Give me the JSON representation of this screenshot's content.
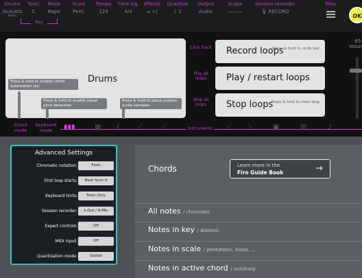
{
  "topbar": {
    "items": [
      {
        "label": "Drums",
        "value": "Acoustic",
        "sub": "Basic"
      },
      {
        "label": "Tonic",
        "value": "C"
      },
      {
        "label": "Mode",
        "value": "Major"
      },
      {
        "label": "Scale",
        "value": "Pent."
      },
      {
        "label": "Tempo",
        "value": "129"
      },
      {
        "label": "Time sig.",
        "value": "4/4"
      },
      {
        "label": "Effects",
        "value": "⩕ >|"
      },
      {
        "label": "Quantize",
        "value": "♪ 2"
      },
      {
        "label": "Output",
        "value": "Audio"
      },
      {
        "label": "Scope",
        "value": "———"
      },
      {
        "label": "Session recorder",
        "value": "🎙 RECORD"
      },
      {
        "label": "Files",
        "value": ""
      }
    ],
    "key_label": "Key",
    "ok_label": "OK",
    "accent_color": "#d63be0"
  },
  "drums": {
    "title": "Drums",
    "hints": {
      "chord_auto": "Press & hold to enable chord automation rec.",
      "pitch_detect": "Press & hold to enable visual pitch detection",
      "custom_samples": "Press & hold to place custom audio samples"
    }
  },
  "middle_buttons": {
    "click_track": "Click track",
    "play_all": "Play all loops",
    "stop_all": "Stop all loops"
  },
  "loops": {
    "record": {
      "label": "Record loops",
      "hint": "Press & hold to undo last"
    },
    "play": {
      "label": "Play / restart loops"
    },
    "stop": {
      "label": "Stop loops",
      "hint": "Press & hold to clear loop"
    }
  },
  "volume": {
    "value": "65",
    "label": "Volume"
  },
  "modes": {
    "chord_mode": "Chord mode",
    "keyboard_mode": "Keyboard mode",
    "instruments": "Instruments"
  },
  "main": {
    "chords_title": "Chords",
    "guide": {
      "line1": "Learn more in the",
      "line2": "Firo Guide Book",
      "arrow": "→"
    },
    "rows": [
      {
        "main": "All notes",
        "sub": "/ chromatic"
      },
      {
        "main": "Notes in key",
        "sub": "/ diatonic"
      },
      {
        "main": "Notes in scale",
        "sub": "/ pentatonic, blues, ..."
      },
      {
        "main": "Notes in active chord",
        "sub": "/ autoharp"
      }
    ]
  },
  "settings": {
    "title": "Advanced Settings",
    "rows": [
      {
        "label": "Chromatic notation:",
        "value": "Flats"
      },
      {
        "label": "First loop starts:",
        "value": "Beat Sync'd"
      },
      {
        "label": "Keyboard hints:",
        "value": "Tonic Only"
      },
      {
        "label": "Session recorder:",
        "value": "L:Out / R:Mic"
      },
      {
        "label": "Expert controls:",
        "value": "Off"
      },
      {
        "label": "MIDI input:",
        "value": "Off"
      },
      {
        "label": "Quantization mode:",
        "value": "Global"
      }
    ],
    "border_color": "#3ec1d3"
  }
}
